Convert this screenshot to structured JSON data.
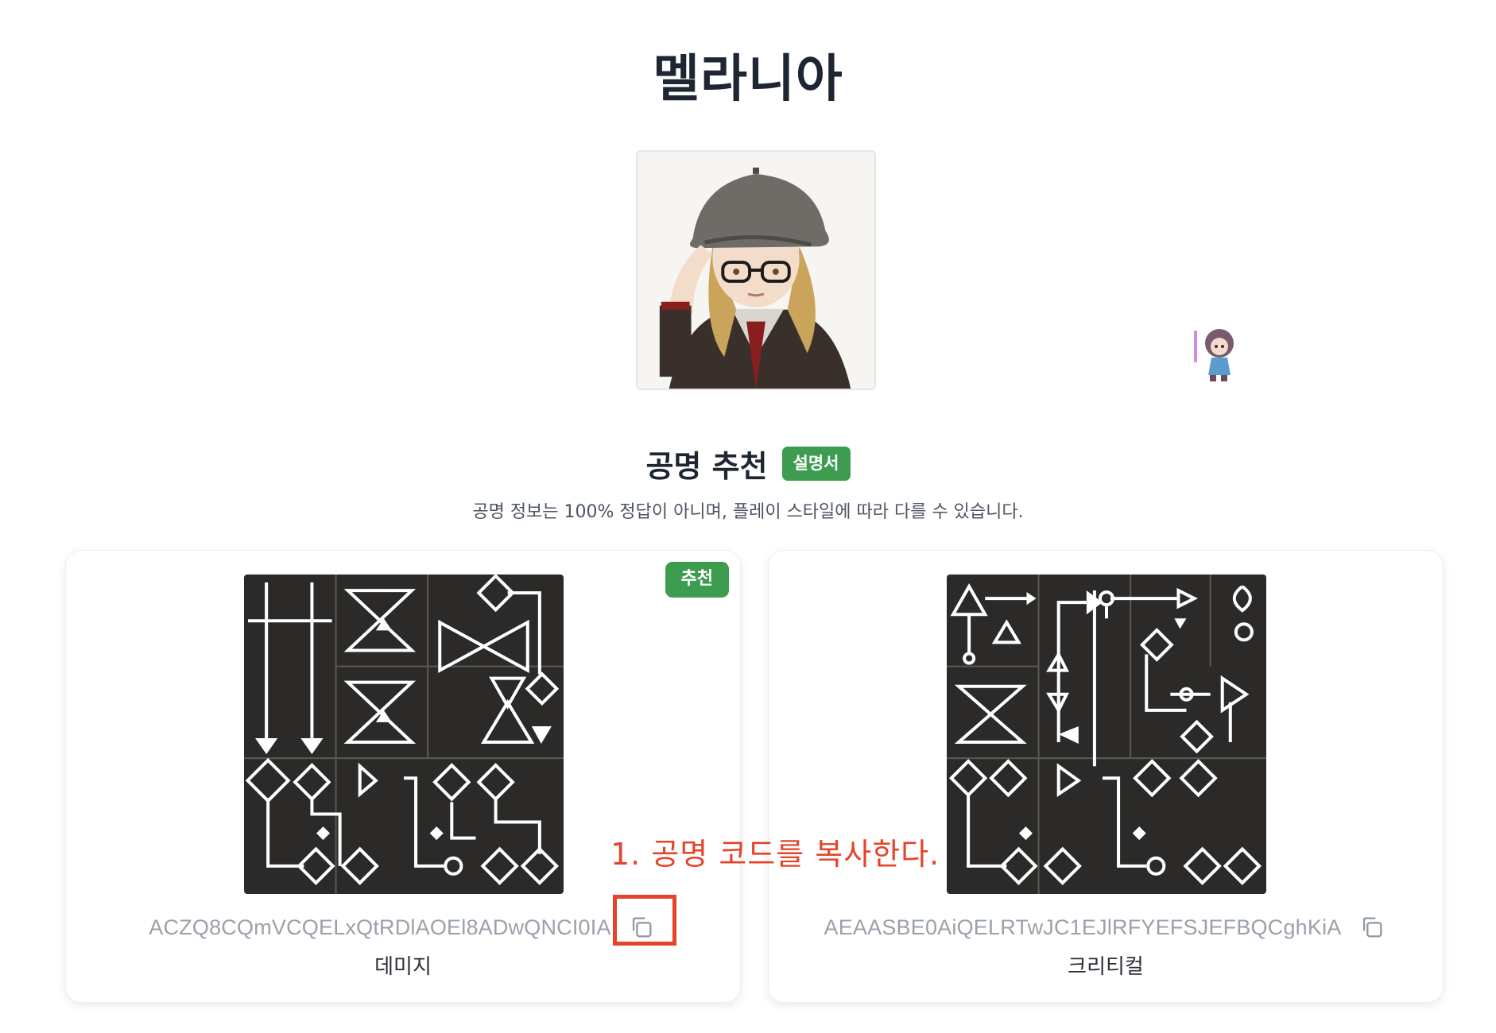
{
  "page": {
    "title": "멜라니아"
  },
  "section": {
    "title": "공명 추천",
    "manual_label": "설명서",
    "description": "공명 정보는 100% 정답이 아니며, 플레이 스타일에 따라 다를 수 있습니다."
  },
  "cards": [
    {
      "badge": "추천",
      "code": "ACZQ8CQmVCQELxQtRDlAOEl8ADwQNCI0IA",
      "label": "데미지",
      "copy_icon": "copy-icon"
    },
    {
      "code": "AEAASBE0AiQELRTwJC1EJlRFYEFSJEFBQCghKiA",
      "label": "크리티컬",
      "copy_icon": "copy-icon"
    }
  ],
  "annotation": {
    "instruction": "1. 공명 코드를 복사한다.",
    "color": "#e5432b"
  },
  "colors": {
    "accent_green": "#3d9c4f",
    "title": "#1e2633",
    "code_gray": "#9aa1ab"
  }
}
